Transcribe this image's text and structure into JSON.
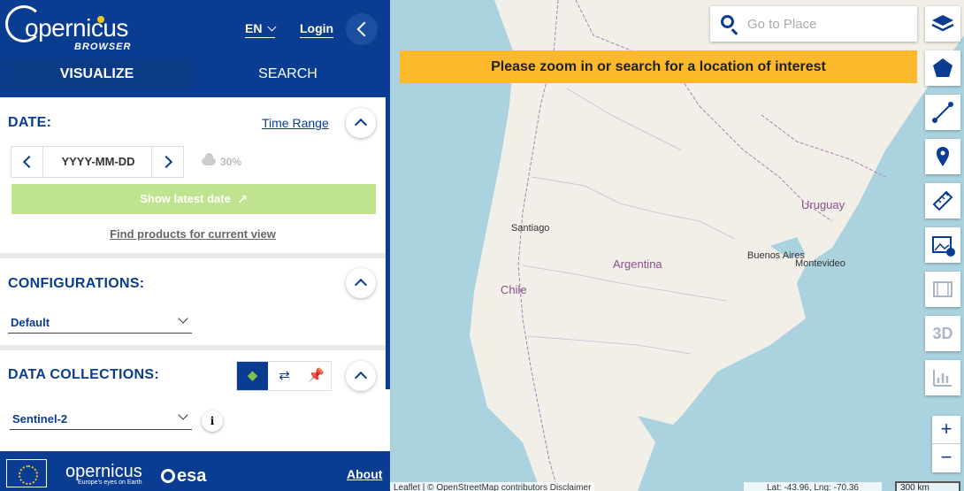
{
  "header": {
    "logo_text": "opernicus",
    "logo_sub": "BROWSER",
    "language": "EN",
    "login": "Login"
  },
  "tabs": [
    {
      "label": "VISUALIZE",
      "active": true
    },
    {
      "label": "SEARCH",
      "active": false
    }
  ],
  "date_section": {
    "title": "DATE:",
    "time_range": "Time Range",
    "date_value": "YYYY-MM-DD",
    "cloud_coverage": "30%",
    "show_latest": "Show latest date",
    "find_products": "Find products for current view"
  },
  "configurations": {
    "title": "CONFIGURATIONS:",
    "selected": "Default"
  },
  "data_collections": {
    "title": "DATA COLLECTIONS:",
    "selected": "Sentinel-2"
  },
  "footer": {
    "copernicus": "opernicus",
    "copernicus_sub": "Europe's eyes on Earth",
    "esa": "esa",
    "about": "About"
  },
  "map": {
    "search_placeholder": "Go to Place",
    "banner": "Please zoom in or search for a location of interest",
    "labels": {
      "santiago": "Santiago",
      "chile": "Chile",
      "argentina": "Argentina",
      "uruguay": "Uruguay",
      "buenos_aires": "Buenos Aires",
      "montevideo": "Montevideo"
    },
    "attribution": "Leaflet | © OpenStreetMap contributors   Disclaimer",
    "coordinates": "Lat: -43.96, Lng: -70.36",
    "scale": "300 km",
    "tool_3d": "3D",
    "zoom_in": "+",
    "zoom_out": "−"
  },
  "colors": {
    "brand_blue": "#0a3d91",
    "banner_yellow": "#fcb92c",
    "latest_button_green": "#bfe38e",
    "sea": "#aad3df",
    "land": "#f2efe9"
  },
  "icons": [
    "layers-icon",
    "polygon-icon",
    "line-icon",
    "pin-icon",
    "ruler-icon",
    "image-download-icon",
    "film-icon",
    "chart-icon"
  ]
}
